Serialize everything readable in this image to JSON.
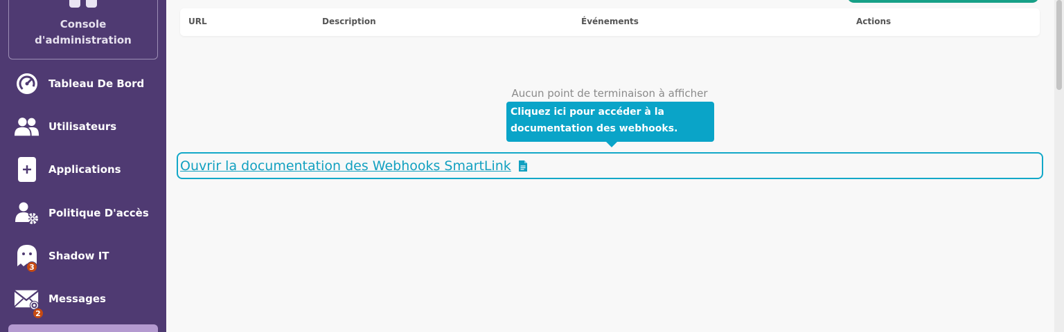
{
  "sidebar": {
    "console_title_line1": "Console",
    "console_title_line2": "d'administration",
    "items": [
      {
        "label": "Tableau De Bord",
        "icon": "dashboard-gauge-icon"
      },
      {
        "label": "Utilisateurs",
        "icon": "users-icon"
      },
      {
        "label": "Applications",
        "icon": "plus-app-icon"
      },
      {
        "label": "Politique D'accès",
        "icon": "user-gear-icon"
      },
      {
        "label": "Shadow IT",
        "icon": "ghost-icon",
        "badge": "3"
      },
      {
        "label": "Messages",
        "icon": "envelope-icon",
        "badge": "2"
      }
    ]
  },
  "table": {
    "columns": [
      "URL",
      "Description",
      "Événements",
      "Actions"
    ]
  },
  "empty_message": "Aucun point de terminaison à afficher",
  "tooltip": {
    "line1": "Cliquez ici pour accéder à la",
    "line2": "documentation des webhooks."
  },
  "doc_link": {
    "label": "Ouvrir la documentation des Webhooks SmartLink",
    "icon": "document-icon"
  },
  "colors": {
    "sidebar_bg": "#4f3a72",
    "accent_cyan": "#0aa4c8",
    "badge_orange": "#c64a12",
    "primary_green": "#17a087"
  }
}
